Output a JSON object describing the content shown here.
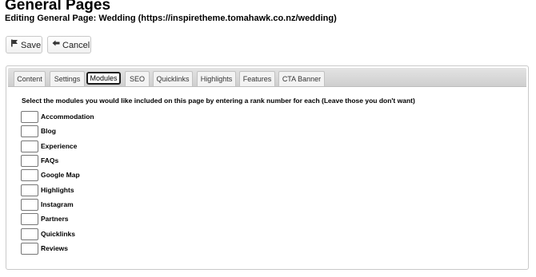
{
  "page": {
    "title": "General Pages",
    "subtitle": "Editing General Page: Wedding   (https://inspiretheme.tomahawk.co.nz/wedding)"
  },
  "toolbar": {
    "save_label": "Save",
    "cancel_label": "Cancel"
  },
  "tabs": [
    {
      "label": "Content",
      "active": false
    },
    {
      "label": "Settings",
      "active": false
    },
    {
      "label": "Modules",
      "active": true
    },
    {
      "label": "SEO",
      "active": false
    },
    {
      "label": "Quicklinks",
      "active": false
    },
    {
      "label": "Highlights",
      "active": false
    },
    {
      "label": "Features",
      "active": false
    },
    {
      "label": "CTA Banner",
      "active": false
    }
  ],
  "modules": {
    "instruction": "Select the modules you would like included on this page by entering a rank number for each (Leave those you don't want)",
    "items": [
      {
        "label": "Accommodation",
        "rank": ""
      },
      {
        "label": "Blog",
        "rank": ""
      },
      {
        "label": "Experience",
        "rank": ""
      },
      {
        "label": "FAQs",
        "rank": ""
      },
      {
        "label": "Google Map",
        "rank": ""
      },
      {
        "label": "Highlights",
        "rank": ""
      },
      {
        "label": "Instagram",
        "rank": ""
      },
      {
        "label": "Partners",
        "rank": ""
      },
      {
        "label": "Quicklinks",
        "rank": ""
      },
      {
        "label": "Reviews",
        "rank": ""
      }
    ]
  },
  "icons": {
    "save": "save-flag-icon",
    "cancel": "arrow-left-icon"
  }
}
